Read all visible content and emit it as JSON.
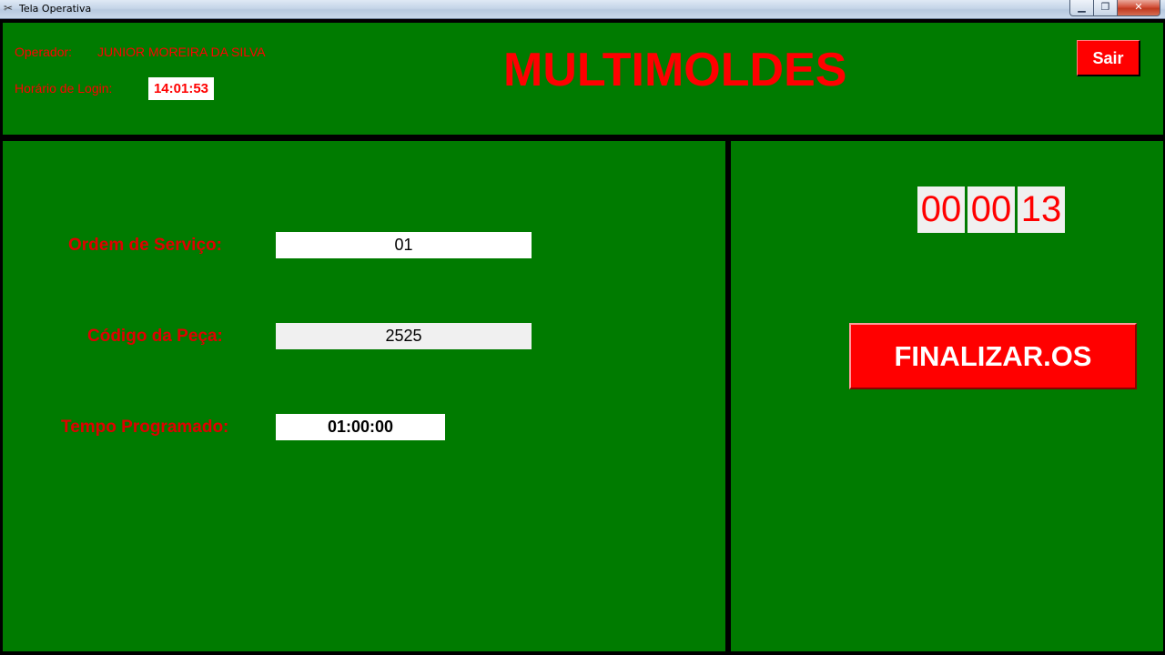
{
  "window": {
    "title": "Tela Operativa",
    "minimize": "▁",
    "maximize": "❐",
    "close": "✕"
  },
  "header": {
    "operator_label": "Operador:",
    "operator_name": "JUNIOR MOREIRA DA SILVA",
    "login_label": "Horário de Login:",
    "login_time": "14:01:53",
    "brand": "MULTIMOLDES",
    "exit_label": "Sair"
  },
  "form": {
    "service_order_label": "Ordem de Serviço:",
    "service_order_value": "01",
    "part_code_label": "Código da Peça:",
    "part_code_value": "2525",
    "programmed_time_label": "Tempo Programado:",
    "programmed_time_value": "01:00:00"
  },
  "timer": {
    "hours": "00",
    "minutes": "00",
    "seconds": "13"
  },
  "actions": {
    "finish_label": "FINALIZAR.OS"
  },
  "colors": {
    "panel_green": "#007b00",
    "accent_red": "#ff0000"
  }
}
